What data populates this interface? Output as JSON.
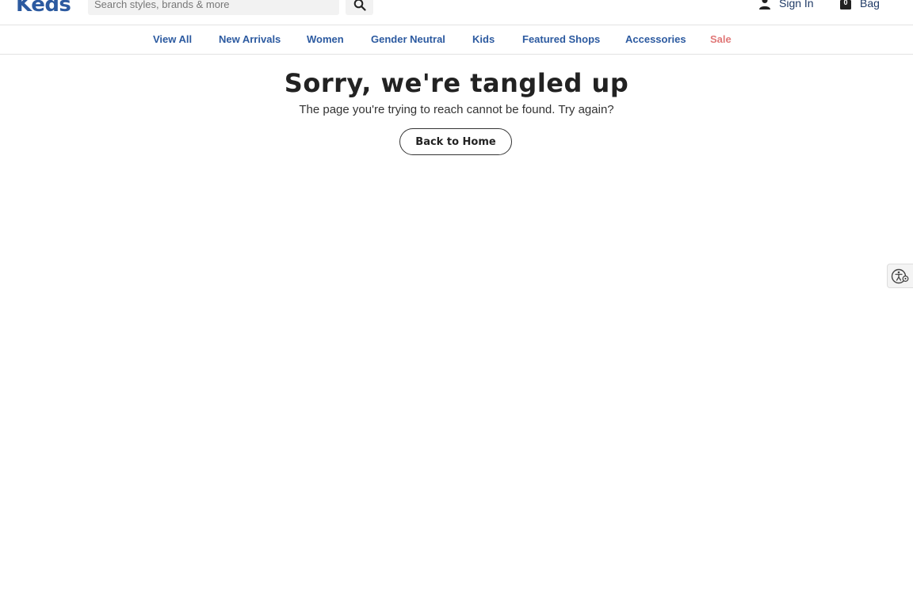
{
  "header": {
    "logo_text": "Keds",
    "search_placeholder": "Search styles, brands & more",
    "signin_label": "Sign In",
    "bag_label": "Bag",
    "bag_count": "0"
  },
  "nav": {
    "items": [
      "View All",
      "New Arrivals",
      "Women",
      "Gender Neutral",
      "Kids",
      "Featured Shops",
      "Accessories",
      "Sale"
    ]
  },
  "main": {
    "heading": "Sorry, we're tangled up",
    "message": "The page you're trying to reach cannot be found. Try again?",
    "button_label": "Back to Home"
  },
  "colors": {
    "brand_blue": "#2c5aa0",
    "sale_red": "#e07878"
  },
  "icons": [
    "search-icon",
    "user-icon",
    "bag-icon",
    "accessibility-icon"
  ]
}
